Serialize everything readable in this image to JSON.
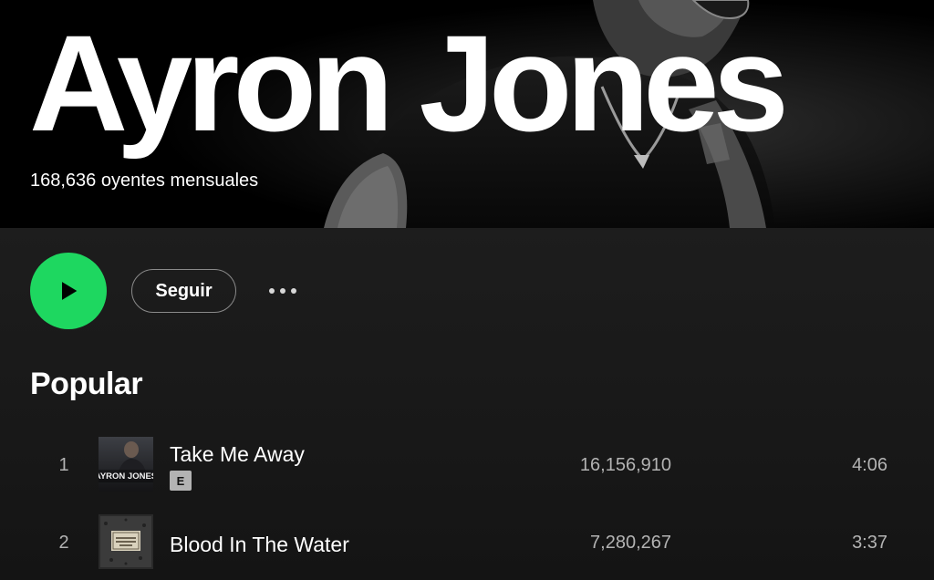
{
  "artist": {
    "name": "Ayron Jones",
    "listeners": "168,636 oyentes mensuales"
  },
  "actions": {
    "play_icon": "play-icon",
    "follow_label": "Seguir",
    "more_icon": "more-options-icon",
    "play_color": "#1ed760"
  },
  "popular": {
    "title": "Popular",
    "tracks": [
      {
        "index": "1",
        "title": "Take Me Away",
        "explicit_label": "E",
        "plays": "16,156,910",
        "duration": "4:06",
        "cover_text": "AYRON JONES"
      },
      {
        "index": "2",
        "title": "Blood In The Water",
        "plays": "7,280,267",
        "duration": "3:37"
      }
    ]
  }
}
